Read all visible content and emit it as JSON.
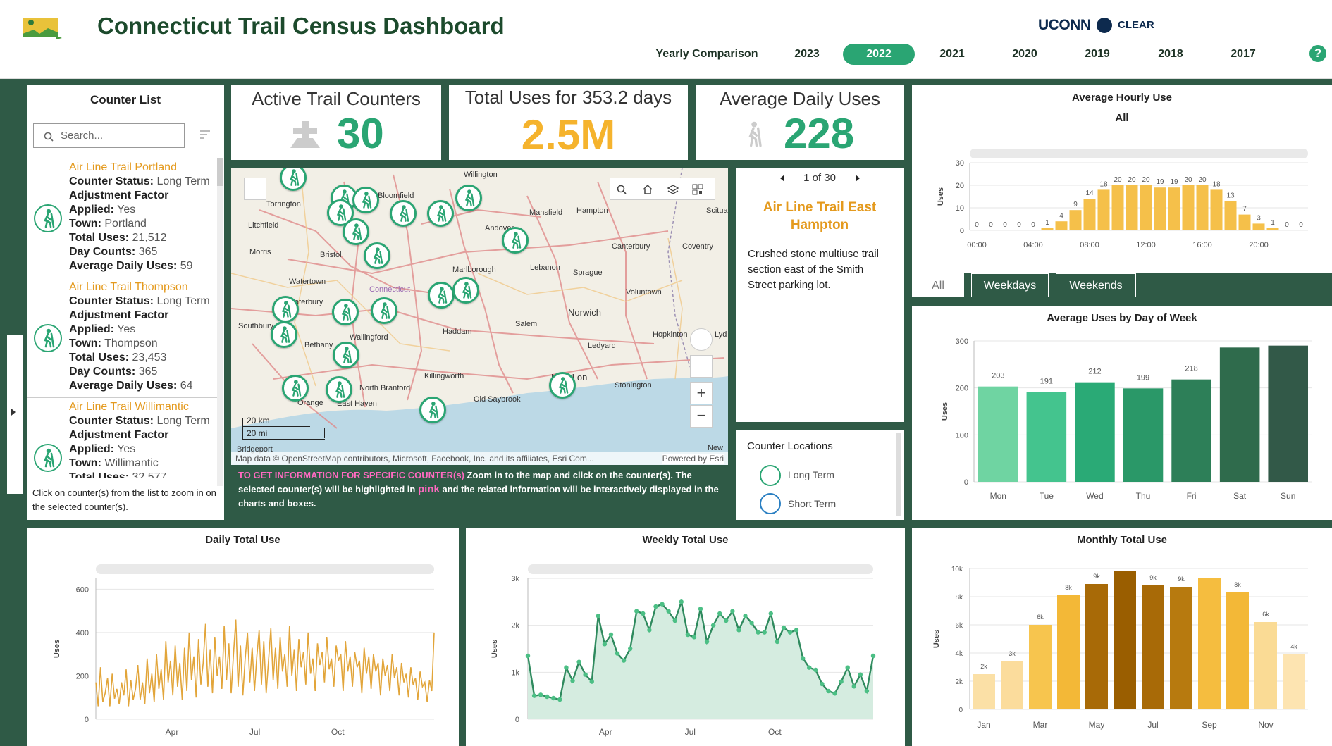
{
  "header": {
    "title": "Connecticut Trail Census Dashboard",
    "uconn": "UCONN",
    "clear": "CLEAR",
    "nav": [
      "Yearly Comparison",
      "2023",
      "2022",
      "2021",
      "2020",
      "2019",
      "2018",
      "2017"
    ],
    "active_year": "2022",
    "help": "?"
  },
  "counter_list": {
    "title": "Counter List",
    "search_placeholder": "Search...",
    "footer": "Click on counter(s) from the list to zoom in on the selected counter(s).",
    "items": [
      {
        "name": "Air Line Trail Portland",
        "status": "Long Term",
        "applied": "Yes",
        "town": "Portland",
        "total_uses": "21,512",
        "day_counts": "365",
        "avg_daily": "59"
      },
      {
        "name": "Air Line Trail Thompson",
        "status": "Long Term",
        "applied": "Yes",
        "town": "Thompson",
        "total_uses": "23,453",
        "day_counts": "365",
        "avg_daily": "64"
      },
      {
        "name": "Air Line Trail Willimantic",
        "status": "Long Term",
        "applied": "Yes",
        "town": "Willimantic",
        "total_uses": "32,577"
      }
    ],
    "labels": {
      "status": "Counter Status:",
      "adj": "Adjustment Factor",
      "applied": "Applied:",
      "town": "Town:",
      "total": "Total Uses:",
      "days": "Day Counts:",
      "avg": "Average Daily Uses:"
    }
  },
  "kpis": {
    "active": {
      "label": "Active Trail Counters",
      "value": "30"
    },
    "total": {
      "label": "Total Uses for 353.2 days",
      "value": "2.5M"
    },
    "avg": {
      "label": "Average Daily Uses",
      "value": "228"
    }
  },
  "map": {
    "attribution": "Map data © OpenStreetMap contributors, Microsoft, Facebook, Inc. and its affiliates, Esri Com...",
    "powered": "Powered by Esri",
    "scale_km": "20 km",
    "scale_mi": "20 mi",
    "places": [
      "Willington",
      "Torrington",
      "Bloomfield",
      "Mansfield",
      "Hampton",
      "Scitua",
      "Litchfield",
      "Andover",
      "Canterbury",
      "Coventry",
      "Morris",
      "Bristol",
      "Lebanon",
      "Sprague",
      "Marlborough",
      "Waterbury",
      "Watertown",
      "Connecticut",
      "Voluntown",
      "Southbury",
      "Haddam",
      "Salem",
      "Norwich",
      "Hopkinton",
      "Lyd",
      "Bethany",
      "Wallingford",
      "Ledyard",
      "Killingworth",
      "New Lon",
      "Stonington",
      "North Branford",
      "Old Saybrook",
      "Orange",
      "East Haven",
      "Bridgeport",
      "New"
    ],
    "info_strong": "TO GET INFORMATION FOR SPECIFIC COUNTER(s)",
    "info_1": " Zoom in to the map and click on the counter(s). The selected counter(s) will be highlighted in ",
    "info_pink": "pink",
    "info_2": " and the related information will be interactively displayed in the charts and boxes."
  },
  "detail": {
    "pager": "1 of 30",
    "name": "Air Line Trail East Hampton",
    "desc": "Crushed stone multiuse trail section east of the Smith Street parking lot."
  },
  "locations": {
    "title": "Counter Locations",
    "items": [
      "Long Term",
      "Short Term"
    ]
  },
  "tabs": [
    "All",
    "Weekdays",
    "Weekends"
  ],
  "colors": {
    "green": "#2aa573",
    "dark": "#2f5a46",
    "orange": "#e49a1e",
    "yellow": "#f5c04a"
  },
  "charts": {
    "hourly": {
      "title": "Average Hourly Use",
      "subtitle": "All"
    },
    "dow": {
      "title": "Average Uses by Day of Week"
    },
    "daily": {
      "title": "Daily Total Use"
    },
    "weekly": {
      "title": "Weekly Total Use"
    },
    "monthly": {
      "title": "Monthly Total Use"
    }
  },
  "chart_data": [
    {
      "id": "hourly",
      "type": "bar",
      "title": "Average Hourly Use",
      "ylabel": "Uses",
      "ylim": [
        0,
        30
      ],
      "yticks": [
        0,
        10,
        20,
        30
      ],
      "x": [
        "00:00",
        "01:00",
        "02:00",
        "03:00",
        "04:00",
        "05:00",
        "06:00",
        "07:00",
        "08:00",
        "09:00",
        "10:00",
        "11:00",
        "12:00",
        "13:00",
        "14:00",
        "15:00",
        "16:00",
        "17:00",
        "18:00",
        "19:00",
        "20:00",
        "21:00",
        "22:00",
        "23:00"
      ],
      "values": [
        0,
        0,
        0,
        0,
        0,
        1,
        4,
        9,
        14,
        18,
        20,
        20,
        20,
        19,
        19,
        20,
        20,
        18,
        13,
        7,
        3,
        1,
        0,
        0
      ],
      "labels": [
        "0",
        "0",
        "0",
        "0",
        "0",
        "1",
        "4",
        "9",
        "14",
        "18",
        "20",
        "20",
        "20",
        "19",
        "19",
        "20",
        "20",
        "18",
        "13",
        "7",
        "3",
        "1",
        "0",
        "0"
      ],
      "xticks": [
        "00:00",
        "04:00",
        "08:00",
        "12:00",
        "16:00",
        "20:00"
      ]
    },
    {
      "id": "dow",
      "type": "bar",
      "title": "Average Uses by Day of Week",
      "ylabel": "Uses",
      "ylim": [
        0,
        300
      ],
      "yticks": [
        0,
        100,
        200,
        300
      ],
      "categories": [
        "Mon",
        "Tue",
        "Wed",
        "Thu",
        "Fri",
        "Sat",
        "Sun"
      ],
      "values": [
        203,
        191,
        212,
        199,
        218,
        286,
        290
      ],
      "labels": [
        "203",
        "191",
        "212",
        "199",
        "218",
        "",
        ""
      ]
    },
    {
      "id": "daily",
      "type": "line",
      "title": "Daily Total Use",
      "ylabel": "Uses",
      "ylim": [
        0,
        650
      ],
      "yticks": [
        0,
        200,
        400,
        600
      ],
      "xticks": [
        "Apr",
        "Jul",
        "Oct"
      ],
      "values": [
        170,
        60,
        240,
        80,
        120,
        190,
        60,
        210,
        95,
        140,
        70,
        170,
        110,
        230,
        60,
        180,
        90,
        140,
        250,
        90,
        170,
        70,
        280,
        120,
        210,
        80,
        300,
        140,
        230,
        90,
        360,
        170,
        270,
        110,
        340,
        150,
        260,
        90,
        330,
        130,
        400,
        180,
        290,
        100,
        370,
        160,
        260,
        440,
        150,
        320,
        120,
        380,
        200,
        290,
        140,
        430,
        180,
        350,
        120,
        300,
        460,
        150,
        340,
        110,
        280,
        400,
        170,
        330,
        130,
        290,
        410,
        160,
        360,
        120,
        270,
        420,
        180,
        330,
        140,
        380,
        220,
        300,
        150,
        430,
        200,
        320,
        130,
        370,
        240,
        310,
        160,
        400,
        210,
        280,
        130,
        350,
        250,
        310,
        170,
        380,
        230,
        280,
        150,
        340,
        270,
        300,
        130,
        360,
        220,
        290,
        150,
        310,
        240,
        270,
        120,
        330,
        210,
        290,
        140,
        300,
        220,
        260,
        110,
        280,
        200,
        250,
        130,
        300,
        190,
        240,
        110,
        260,
        170,
        210,
        100,
        240,
        160,
        190,
        90,
        220,
        150,
        170,
        80,
        180,
        130,
        400
      ]
    },
    {
      "id": "weekly",
      "type": "area",
      "title": "Weekly Total Use",
      "ylabel": "Uses",
      "ylim": [
        0,
        3000
      ],
      "yticks": [
        "0",
        "1k",
        "2k",
        "3k"
      ],
      "xticks": [
        "Apr",
        "Jul",
        "Oct"
      ],
      "values": [
        1350,
        500,
        520,
        480,
        450,
        420,
        1100,
        820,
        1220,
        950,
        800,
        2200,
        1600,
        1800,
        1400,
        1250,
        1500,
        2300,
        2250,
        1900,
        2400,
        2450,
        2300,
        2100,
        2500,
        1800,
        1750,
        2350,
        1650,
        2000,
        2250,
        2100,
        2300,
        1900,
        2200,
        2050,
        1850,
        1850,
        2250,
        1650,
        1950,
        1850,
        1900,
        1300,
        1100,
        1050,
        750,
        600,
        550,
        800,
        1100,
        700,
        950,
        600,
        1350
      ]
    },
    {
      "id": "monthly",
      "type": "bar",
      "title": "Monthly Total Use",
      "ylabel": "Uses",
      "ylim": [
        0,
        10000
      ],
      "yticks": [
        "0",
        "2k",
        "4k",
        "6k",
        "8k",
        "10k"
      ],
      "categories": [
        "Jan",
        "Feb",
        "Mar",
        "Apr",
        "May",
        "Jun",
        "Jul",
        "Aug",
        "Sep",
        "Oct",
        "Nov",
        "Dec"
      ],
      "values": [
        2500,
        3400,
        6000,
        8100,
        8900,
        9800,
        8800,
        8700,
        9300,
        8300,
        6200,
        3900
      ],
      "labels": [
        "2k",
        "3k",
        "6k",
        "8k",
        "9k",
        "",
        "9k",
        "9k",
        "",
        "8k",
        "6k",
        "4k"
      ],
      "xticks": [
        "Jan",
        "Mar",
        "May",
        "Jul",
        "Sep",
        "Nov"
      ]
    }
  ]
}
